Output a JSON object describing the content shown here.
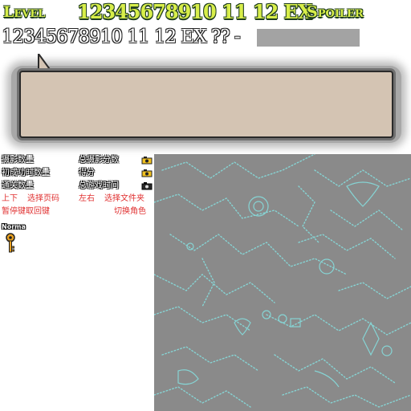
{
  "header": {
    "level_label": "Level",
    "level_numbers": "12345678910 11 12 EX",
    "spoiler_label": "Spoiler"
  },
  "row2": {
    "numbers": "12345678910 11 12 EX ?? -"
  },
  "hud": {
    "stat_photos": "摄影数量",
    "stat_total_photos": "总摄影分数",
    "stat_first_success": "初成功时数量",
    "stat_score": "得分",
    "stat_clear_count": "通关数量",
    "stat_total_time": "总游戏时间",
    "up_down": "上下",
    "select_page": "选择页码",
    "left_right": "左右",
    "select_folder": "选择文件夹",
    "pause_key": "暂停键取回键",
    "switch_character": "切换角色"
  },
  "difficulty": "Norma",
  "colors": {
    "title_yellow": "#d8ee4a",
    "dialog_fill": "#d4c4b3",
    "spoiler_bar": "#a3a3a3",
    "pattern_bg": "#8a8a8a",
    "pattern_lines": "#86d4d4",
    "red_text": "#e03030"
  },
  "icons": [
    "camera-icon",
    "key-icon"
  ]
}
